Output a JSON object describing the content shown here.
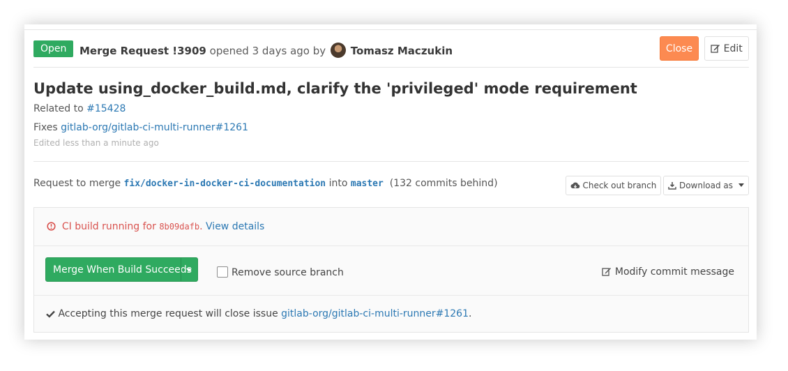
{
  "header": {
    "status_badge": "Open",
    "mr_label": "Merge Request !3909",
    "opened_text": "opened 3 days ago by",
    "author": "Tomasz Maczukin",
    "close_label": "Close",
    "edit_label": "Edit"
  },
  "title": "Update using_docker_build.md, clarify the 'privileged' mode requirement",
  "description": {
    "related_prefix": "Related to",
    "related_link": "#15428",
    "fixes_prefix": "Fixes",
    "fixes_link": "gitlab-org/gitlab-ci-multi-runner#1261",
    "edited": "Edited less than a minute ago"
  },
  "merge_info": {
    "prefix": "Request to merge",
    "source_branch": "fix/docker-in-docker-ci-documentation",
    "into": "into",
    "target_branch": "master",
    "behind": "(132 commits behind)",
    "checkout_label": "Check out branch",
    "download_label": "Download as"
  },
  "ci": {
    "text": "CI build running for",
    "sha": "8b09dafb",
    "details_link": "View details"
  },
  "merge_widget": {
    "merge_button": "Merge When Build Succeeds",
    "remove_source": "Remove source branch",
    "modify_commit": "Modify commit message",
    "accept_text": "Accepting this merge request will close issue",
    "accept_link": "gitlab-org/gitlab-ci-multi-runner#1261"
  },
  "colors": {
    "open_green": "#2faa60",
    "close_orange": "#fc8a51",
    "link_blue": "#2b78b3",
    "ci_red": "#d9534f"
  }
}
